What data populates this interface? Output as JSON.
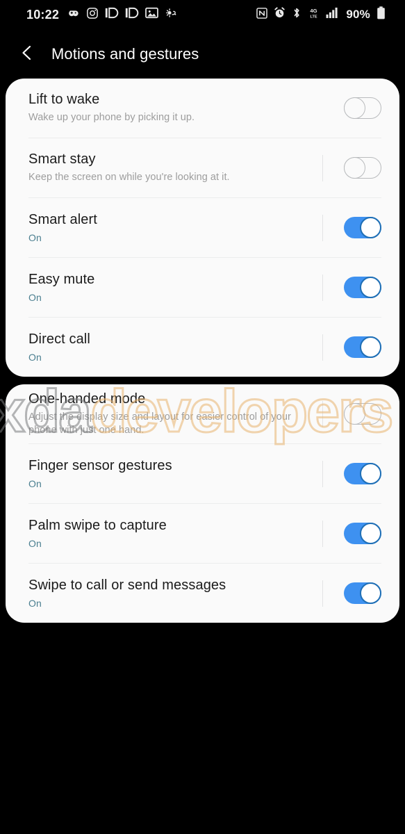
{
  "status_bar": {
    "time": "10:22",
    "battery_percent": "90%",
    "left_icons": [
      {
        "name": "game-controller-icon"
      },
      {
        "name": "instagram-icon"
      },
      {
        "name": "notification-badge-icon-1"
      },
      {
        "name": "notification-badge-icon-2"
      },
      {
        "name": "gallery-image-icon"
      },
      {
        "name": "weather-sun-icon"
      }
    ],
    "right_icons": [
      {
        "name": "nfc-icon"
      },
      {
        "name": "alarm-clock-icon"
      },
      {
        "name": "bluetooth-icon"
      },
      {
        "name": "network-4g-lte-icon"
      },
      {
        "name": "signal-bars-icon"
      },
      {
        "name": "battery-icon"
      }
    ]
  },
  "header": {
    "back_icon": "back-chevron-icon",
    "title": "Motions and gestures"
  },
  "cards": [
    {
      "id": "card1",
      "rows": [
        {
          "title": "Lift to wake",
          "subtitle": "Wake up your phone by picking it up.",
          "sub_is_state": false,
          "toggle": "off",
          "show_vbar": false
        },
        {
          "title": "Smart stay",
          "subtitle": "Keep the screen on while you're looking at it.",
          "sub_is_state": false,
          "toggle": "off",
          "show_vbar": true
        },
        {
          "title": "Smart alert",
          "subtitle": "On",
          "sub_is_state": true,
          "toggle": "on",
          "show_vbar": true
        },
        {
          "title": "Easy mute",
          "subtitle": "On",
          "sub_is_state": true,
          "toggle": "on",
          "show_vbar": true
        },
        {
          "title": "Direct call",
          "subtitle": "On",
          "sub_is_state": true,
          "toggle": "on",
          "show_vbar": true
        }
      ]
    },
    {
      "id": "card2",
      "rows": [
        {
          "title": "One-handed mode",
          "subtitle": "Adjust the display size and layout for easier control of your phone with just one hand.",
          "sub_is_state": false,
          "toggle": "off",
          "show_vbar": true
        },
        {
          "title": "Finger sensor gestures",
          "subtitle": "On",
          "sub_is_state": true,
          "toggle": "on",
          "show_vbar": true
        },
        {
          "title": "Palm swipe to capture",
          "subtitle": "On",
          "sub_is_state": true,
          "toggle": "on",
          "show_vbar": true
        },
        {
          "title": "Swipe to call or send messages",
          "subtitle": "On",
          "sub_is_state": true,
          "toggle": "on",
          "show_vbar": true
        }
      ]
    }
  ],
  "watermark": {
    "part1": "xda",
    "part2": "developers"
  },
  "colors": {
    "toggle_on": "#3e91f0",
    "toggle_on_knob_border": "#1f6fb5",
    "toggle_off_border": "#b9bbbd",
    "state_text": "#4b7f90",
    "card_bg": "#fafafa",
    "screen_bg": "#000000",
    "title_text": "#1b1b1b",
    "subtitle_text": "#9d9d9d",
    "watermark_orange": "#e8b26e"
  }
}
